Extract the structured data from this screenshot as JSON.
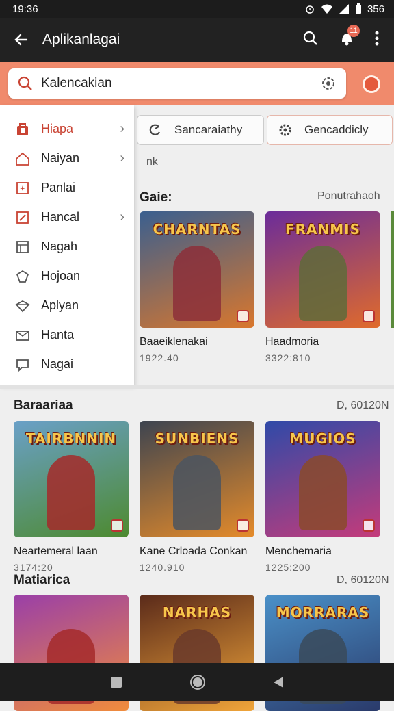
{
  "status": {
    "time": "19:36",
    "battery_text": "356"
  },
  "app_bar": {
    "title": "Aplikanlagai",
    "badge": "11"
  },
  "search": {
    "value": "Kalencakian"
  },
  "drawer": {
    "items": [
      {
        "label": "Hiapa",
        "icon": "bag-icon",
        "chevron": true,
        "active": true
      },
      {
        "label": "Naiyan",
        "icon": "home-icon",
        "chevron": true
      },
      {
        "label": "Panlai",
        "icon": "sparkle-frame-icon",
        "chevron": false
      },
      {
        "label": "Hancal",
        "icon": "edit-icon",
        "chevron": true
      },
      {
        "label": "Nagah",
        "icon": "layout-icon",
        "chevron": false
      },
      {
        "label": "Hojoan",
        "icon": "shield-icon",
        "chevron": false
      },
      {
        "label": "Aplyan",
        "icon": "diamond-icon",
        "chevron": false
      },
      {
        "label": "Hanta",
        "icon": "mail-icon",
        "chevron": false
      },
      {
        "label": "Nagai",
        "icon": "chat-icon",
        "chevron": false
      }
    ]
  },
  "chips": [
    {
      "label": "Sancaraiathy",
      "icon": "refresh-icon"
    },
    {
      "label": "Gencaddicly",
      "icon": "gear-icon"
    }
  ],
  "note": "nk",
  "sections": [
    {
      "title": "Gaie:",
      "link": "Ponutrahaoh",
      "cards": [
        {
          "name": "Baaeiklenakai",
          "meta": "1922.40",
          "art": "CHARNTAS",
          "c1": "#3a5f8f",
          "c2": "#d9772d",
          "fig": "#8c2f3a"
        },
        {
          "name": "Haadmoria",
          "meta": "3322:810",
          "art": "FRANMIS",
          "c1": "#6b2c9a",
          "c2": "#e06b2b",
          "fig": "#5e6b3a"
        }
      ]
    },
    {
      "title": "Baraariaa",
      "link": "D, 60120N",
      "cards": [
        {
          "name": "Neartemeral laan",
          "meta": "3174:20",
          "art": "TAIRBNNIN",
          "c1": "#6aa0c8",
          "c2": "#4d8a2f",
          "fig": "#a52a2a"
        },
        {
          "name": "Kane Crloada Conkan",
          "meta": "1240.910",
          "art": "SUNBIENS",
          "c1": "#3d4450",
          "c2": "#e58b2a",
          "fig": "#4b5560"
        },
        {
          "name": "Menchemaria",
          "meta": "1225:200",
          "art": "MUGIOS",
          "c1": "#2f4aa8",
          "c2": "#c53b7a",
          "fig": "#8a4a2a"
        }
      ]
    },
    {
      "title": "Matiarica",
      "link": "D, 60120N",
      "cards": [
        {
          "name": "",
          "meta": "",
          "art": "",
          "c1": "#9a3fa8",
          "c2": "#f08c3c",
          "fig": "#a52a2a"
        },
        {
          "name": "",
          "meta": "",
          "art": "NARHAS",
          "c1": "#5a2a1a",
          "c2": "#f0a53a",
          "fig": "#6a3a2a"
        },
        {
          "name": "",
          "meta": "",
          "art": "MORRARAS",
          "c1": "#4a90c8",
          "c2": "#2a3a6a",
          "fig": "#3a4a5a"
        }
      ]
    }
  ]
}
